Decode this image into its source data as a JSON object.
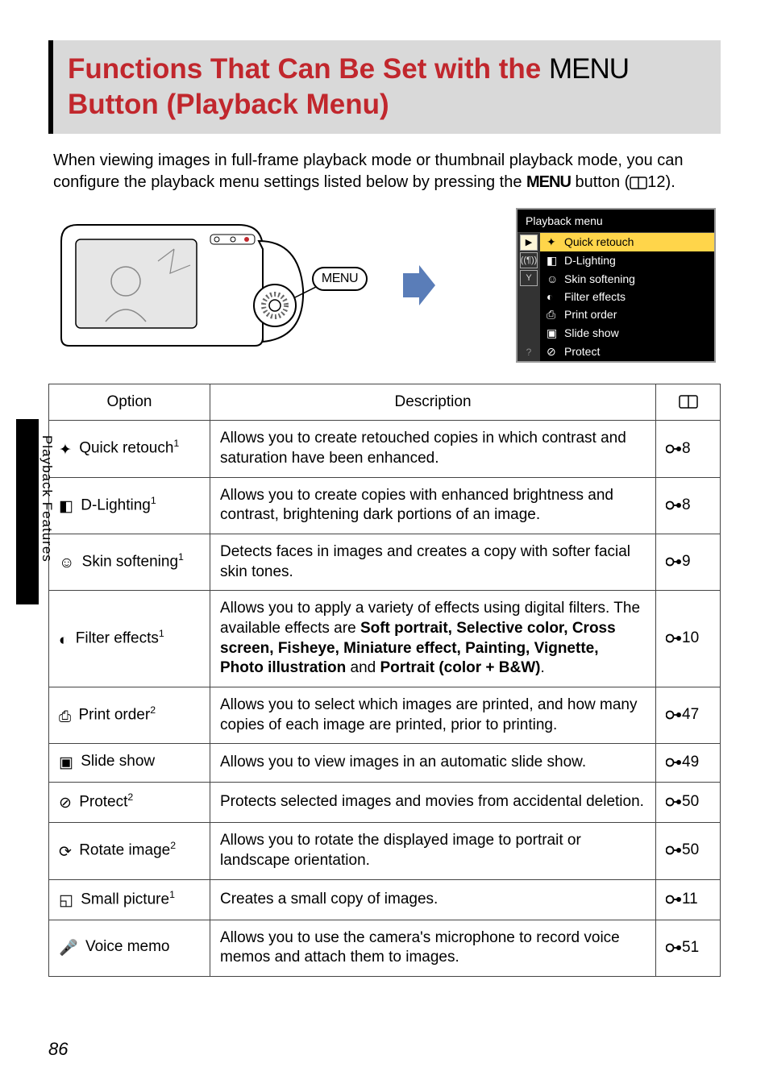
{
  "side_label": "Playback Features",
  "title_pre": "Functions That Can Be Set with the ",
  "title_menu": "MENU",
  "title_post": " Button (Playback Menu)",
  "intro_a": "When viewing images in full-frame playback mode or thumbnail playback mode, you can configure the playback menu settings listed below by pressing the ",
  "intro_menu": "MENU",
  "intro_b": " button (",
  "intro_ref": "12",
  "intro_c": ").",
  "lcd": {
    "header": "Playback menu",
    "items": [
      {
        "icon": "✦",
        "label": "Quick retouch",
        "selected": true
      },
      {
        "icon": "◧",
        "label": "D-Lighting",
        "selected": false
      },
      {
        "icon": "☺",
        "label": "Skin softening",
        "selected": false
      },
      {
        "icon": "◐",
        "label": "Filter effects",
        "selected": false
      },
      {
        "icon": "⎙",
        "label": "Print order",
        "selected": false
      },
      {
        "icon": "▣",
        "label": "Slide show",
        "selected": false
      },
      {
        "icon": "⊘",
        "label": "Protect",
        "selected": false
      }
    ]
  },
  "table": {
    "head_option": "Option",
    "head_desc": "Description",
    "rows": [
      {
        "icon": "✦",
        "option": "Quick retouch",
        "sup": "1",
        "desc_plain": "Allows you to create retouched copies in which contrast and saturation have been enhanced.",
        "ref": "8"
      },
      {
        "icon": "◧",
        "option": "D-Lighting",
        "sup": "1",
        "desc_plain": "Allows you to create copies with enhanced brightness and contrast, brightening dark portions of an image.",
        "ref": "8"
      },
      {
        "icon": "☺",
        "option": "Skin softening",
        "sup": "1",
        "desc_plain": "Detects faces in images and creates a copy with softer facial skin tones.",
        "ref": "9"
      },
      {
        "icon": "◐",
        "option": "Filter effects",
        "sup": "1",
        "desc_pre": "Allows you to apply a variety of effects using digital filters. The available effects are ",
        "desc_bold_list": "Soft portrait, Selective color, Cross screen, Fisheye, Miniature effect, Painting, Vignette, Photo illustration",
        "desc_and": " and ",
        "desc_bold_tail": "Portrait (color + B&W)",
        "desc_post": ".",
        "ref": "10"
      },
      {
        "icon": "⎙",
        "option": "Print order",
        "sup": "2",
        "desc_plain": "Allows you to select which images are printed, and how many copies of each image are printed, prior to printing.",
        "ref": "47"
      },
      {
        "icon": "▣",
        "option": "Slide show",
        "sup": "",
        "desc_plain": "Allows you to view images in an automatic slide show.",
        "ref": "49"
      },
      {
        "icon": "⊘",
        "option": "Protect",
        "sup": "2",
        "desc_plain": "Protects selected images and movies from accidental deletion.",
        "ref": "50"
      },
      {
        "icon": "⟳",
        "option": "Rotate image",
        "sup": "2",
        "desc_plain": "Allows you to rotate the displayed image to portrait or landscape orientation.",
        "ref": "50"
      },
      {
        "icon": "◱",
        "option": "Small picture",
        "sup": "1",
        "desc_plain": "Creates a small copy of images.",
        "ref": "11"
      },
      {
        "icon": "🎤",
        "option": "Voice memo",
        "sup": "",
        "desc_plain": "Allows you to use the camera's microphone to record voice memos and attach them to images.",
        "ref": "51"
      }
    ]
  },
  "page_number": "86"
}
